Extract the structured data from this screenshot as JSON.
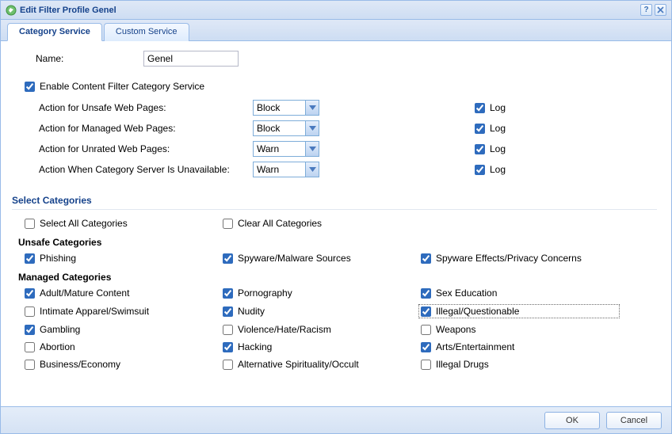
{
  "window_title": "Edit Filter Profile Genel",
  "tabs": {
    "category_service": "Category Service",
    "custom_service": "Custom Service"
  },
  "form": {
    "name_label": "Name:",
    "name_value": "Genel",
    "enable_label": "Enable Content Filter Category Service",
    "enable_checked": true,
    "actions": [
      {
        "label": "Action for Unsafe Web Pages:",
        "value": "Block",
        "log_checked": true
      },
      {
        "label": "Action for Managed Web Pages:",
        "value": "Block",
        "log_checked": true
      },
      {
        "label": "Action for Unrated Web Pages:",
        "value": "Warn",
        "log_checked": true
      },
      {
        "label": "Action When Category Server Is Unavailable:",
        "value": "Warn",
        "log_checked": true
      }
    ],
    "log_label": "Log"
  },
  "select_categories_title": "Select Categories",
  "select_all_label": "Select All Categories",
  "clear_all_label": "Clear All Categories",
  "unsafe_title": "Unsafe Categories",
  "unsafe": [
    {
      "label": "Phishing",
      "checked": true
    },
    {
      "label": "Spyware/Malware Sources",
      "checked": true
    },
    {
      "label": "Spyware Effects/Privacy Concerns",
      "checked": true
    }
  ],
  "managed_title": "Managed Categories",
  "managed": [
    {
      "label": "Adult/Mature Content",
      "checked": true
    },
    {
      "label": "Pornography",
      "checked": true
    },
    {
      "label": "Sex Education",
      "checked": true
    },
    {
      "label": "Intimate Apparel/Swimsuit",
      "checked": false
    },
    {
      "label": "Nudity",
      "checked": true
    },
    {
      "label": "Illegal/Questionable",
      "checked": true,
      "focused": true
    },
    {
      "label": "Gambling",
      "checked": true
    },
    {
      "label": "Violence/Hate/Racism",
      "checked": false
    },
    {
      "label": "Weapons",
      "checked": false
    },
    {
      "label": "Abortion",
      "checked": false
    },
    {
      "label": "Hacking",
      "checked": true
    },
    {
      "label": "Arts/Entertainment",
      "checked": true
    },
    {
      "label": "Business/Economy",
      "checked": false
    },
    {
      "label": "Alternative Spirituality/Occult",
      "checked": false
    },
    {
      "label": "Illegal Drugs",
      "checked": false
    }
  ],
  "footer": {
    "ok": "OK",
    "cancel": "Cancel"
  }
}
